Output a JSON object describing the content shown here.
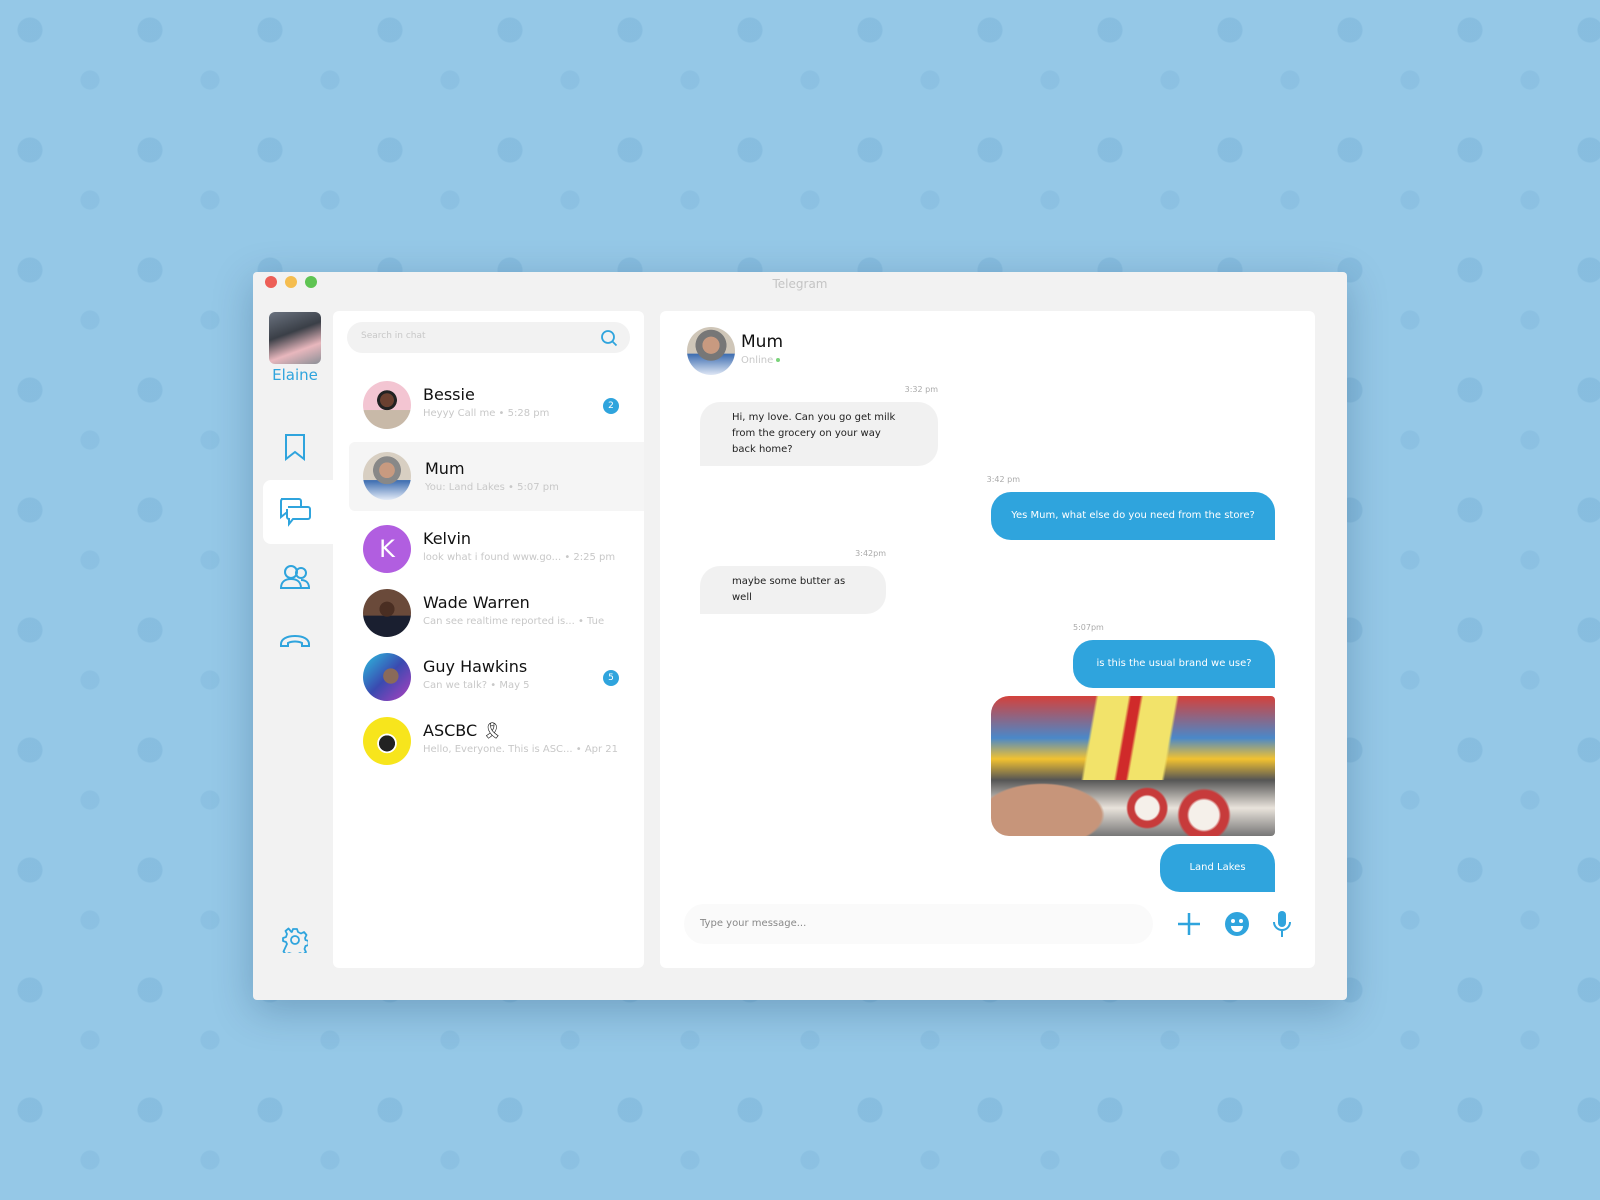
{
  "window": {
    "title": "Telegram"
  },
  "user": {
    "name": "Elaine"
  },
  "rail": {
    "icons": [
      "bookmark-icon",
      "chat-icon",
      "contacts-icon",
      "phone-icon",
      "settings-icon"
    ],
    "active": "chat-icon"
  },
  "search": {
    "placeholder": "Search in chat"
  },
  "chats": [
    {
      "name": "Bessie",
      "preview": "Heyyy Call me • 5:28 pm",
      "badge": "2"
    },
    {
      "name": "Mum",
      "preview": "You: Land Lakes • 5:07 pm",
      "selected": true
    },
    {
      "name": "Kelvin",
      "preview": "look what i found www.go... • 2:25 pm",
      "initial": "K"
    },
    {
      "name": "Wade Warren",
      "preview": "Can see realtime reported is... • Tue"
    },
    {
      "name": "Guy Hawkins",
      "preview": "Can we talk? • May 5",
      "badge": "5"
    },
    {
      "name": "ASCBC 🎗",
      "preview": "Hello, Everyone. This is ASC... • Apr 21"
    }
  ],
  "conversation": {
    "name": "Mum",
    "status": "Online",
    "messages": [
      {
        "time": "3:32 pm",
        "text": "Hi, my love. Can you go get milk from the grocery on your way back home?",
        "dir": "in"
      },
      {
        "time": "3:42 pm",
        "text": "Yes Mum, what else do you need from the store?",
        "dir": "out"
      },
      {
        "time": "3:42pm",
        "text": "maybe some butter as well",
        "dir": "in"
      },
      {
        "time": "5:07pm",
        "text": "is this the usual brand we use?",
        "dir": "out"
      },
      {
        "text": "Land Lakes",
        "dir": "out"
      }
    ],
    "image_label": "Land O Lakes butter photo"
  },
  "composer": {
    "placeholder": "Type your message..."
  },
  "colors": {
    "accent": "#2fa4dd",
    "background": "#95c8e7",
    "online": "#7ad37a"
  }
}
